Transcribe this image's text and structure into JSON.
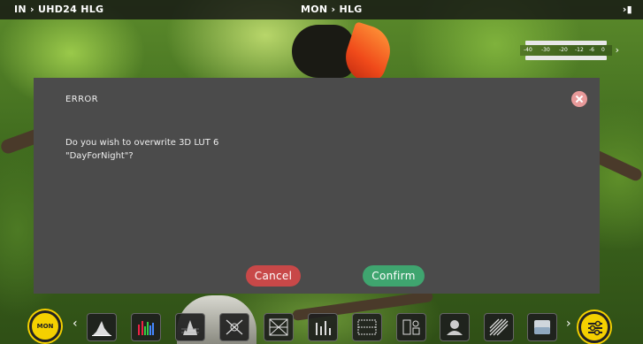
{
  "topbar": {
    "input_label": "IN › UHD24 HLG",
    "mode_label": "MON  › HLG",
    "battery_label": "›▮"
  },
  "audio_meter": {
    "scale": [
      "-40",
      "-30",
      "-20",
      "-12",
      "-6",
      "0"
    ],
    "chevron": "›"
  },
  "dialog": {
    "title": "ERROR",
    "message_line1": "Do you wish to overwrite 3D LUT 6",
    "message_line2": "\"DayForNight\"?",
    "cancel_label": "Cancel",
    "confirm_label": "Confirm"
  },
  "toolbar": {
    "mon_label": "MON",
    "left_arrow": "‹",
    "right_arrow": "›",
    "tools": [
      {
        "icon": "waveform-icon"
      },
      {
        "icon": "rgb-parade-icon"
      },
      {
        "icon": "vectorscope-histogram-icon"
      },
      {
        "icon": "focus-peaking-icon"
      },
      {
        "icon": "false-color-icon"
      },
      {
        "icon": "audio-levels-icon"
      },
      {
        "icon": "frame-guides-icon"
      },
      {
        "icon": "anamorphic-desqueeze-icon"
      },
      {
        "icon": "face-detect-icon"
      },
      {
        "icon": "zebra-icon"
      },
      {
        "icon": "lut-icon"
      }
    ],
    "settings_icon": "settings-sliders-icon"
  }
}
